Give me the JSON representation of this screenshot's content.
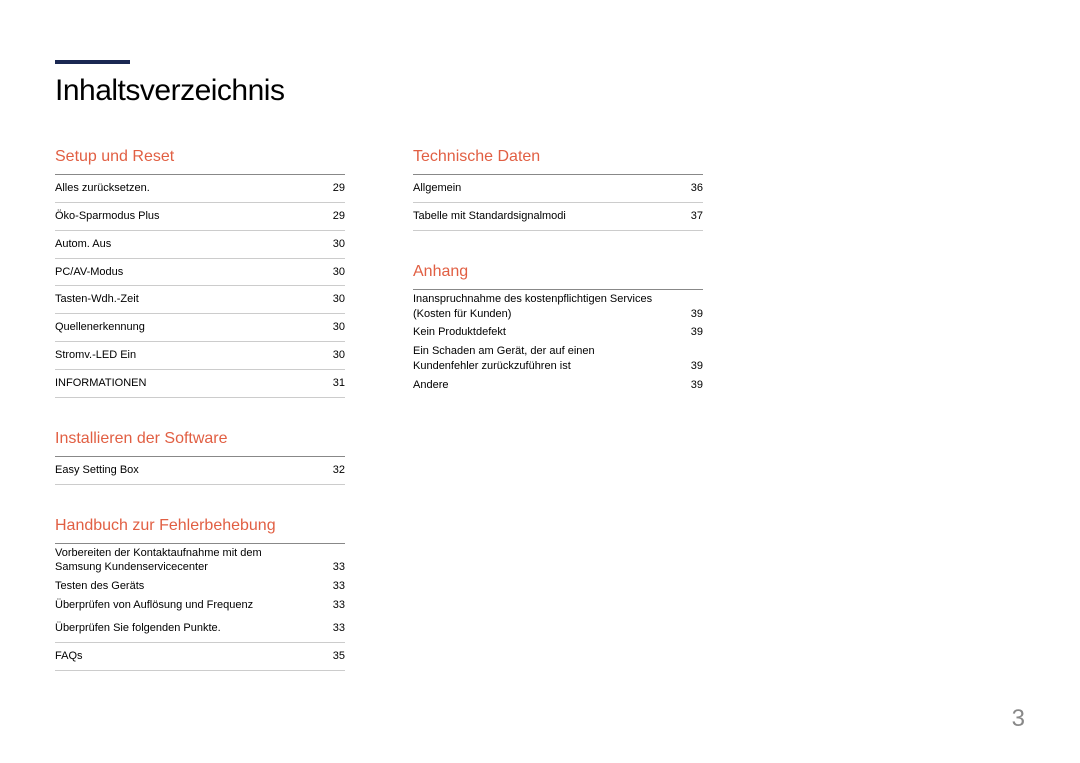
{
  "title": "Inhaltsverzeichnis",
  "page_number": "3",
  "columns": [
    {
      "sections": [
        {
          "heading": "Setup und Reset",
          "entries": [
            {
              "label": "Alles zurücksetzen.",
              "page": "29",
              "border": true
            },
            {
              "label": "Öko-Sparmodus Plus",
              "page": "29",
              "border": true
            },
            {
              "label": "Autom. Aus",
              "page": "30",
              "border": true
            },
            {
              "label": "PC/AV-Modus",
              "page": "30",
              "border": true
            },
            {
              "label": "Tasten-Wdh.-Zeit",
              "page": "30",
              "border": true
            },
            {
              "label": "Quellenerkennung",
              "page": "30",
              "border": true
            },
            {
              "label": "Stromv.-LED Ein",
              "page": "30",
              "border": true
            },
            {
              "label": "INFORMATIONEN",
              "page": "31",
              "border": true
            }
          ]
        },
        {
          "heading": "Installieren der Software",
          "entries": [
            {
              "label": "Easy Setting Box",
              "page": "32",
              "border": true
            }
          ]
        },
        {
          "heading": "Handbuch zur Fehlerbehebung",
          "entries": [
            {
              "label": "Vorbereiten der Kontaktaufnahme mit dem Samsung Kundenservicecenter",
              "page": "33",
              "border": false
            },
            {
              "label": "Testen des Geräts",
              "page": "33",
              "border": false
            },
            {
              "label": "Überprüfen von Auflösung und Frequenz",
              "page": "33",
              "border": false
            },
            {
              "label": "Überprüfen Sie folgenden Punkte.",
              "page": "33",
              "border": true
            },
            {
              "label": "FAQs",
              "page": "35",
              "border": true
            }
          ]
        }
      ]
    },
    {
      "sections": [
        {
          "heading": "Technische Daten",
          "entries": [
            {
              "label": "Allgemein",
              "page": "36",
              "border": true
            },
            {
              "label": "Tabelle mit Standardsignalmodi",
              "page": "37",
              "border": true
            }
          ]
        },
        {
          "heading": "Anhang",
          "entries": [
            {
              "label": "Inanspruchnahme des kostenpflichtigen Services (Kosten für Kunden)",
              "page": "39",
              "border": false
            },
            {
              "label": "Kein Produktdefekt",
              "page": "39",
              "border": false
            },
            {
              "label": "Ein Schaden am Gerät, der auf einen Kundenfehler zurückzuführen ist",
              "page": "39",
              "border": false
            },
            {
              "label": "Andere",
              "page": "39",
              "border": false
            }
          ]
        }
      ]
    }
  ]
}
